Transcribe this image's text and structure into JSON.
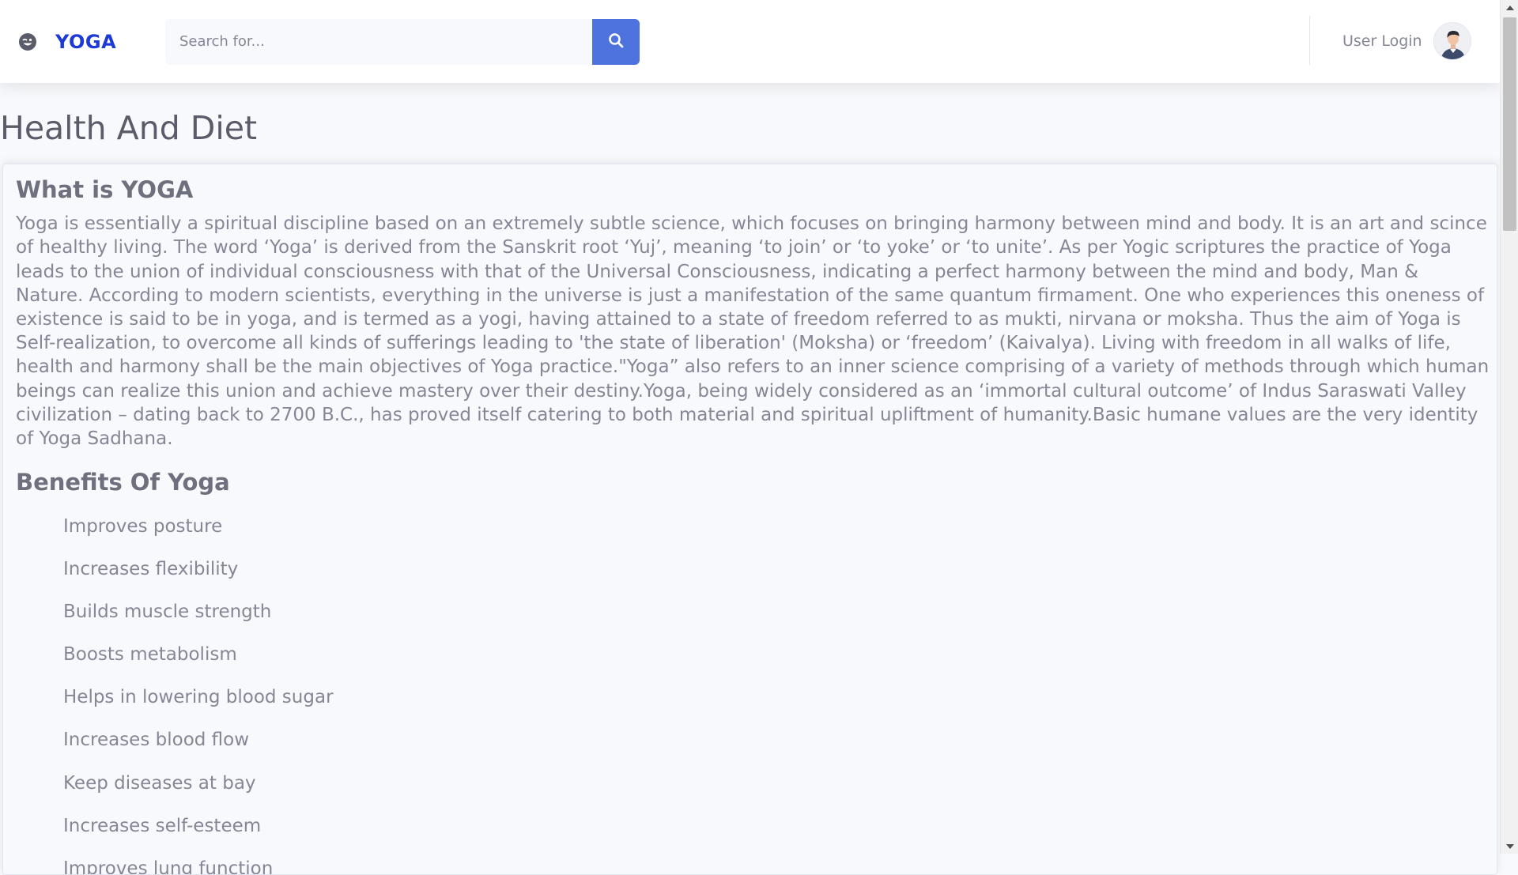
{
  "header": {
    "brand": "YOGA",
    "brand_icon": "wink-face-icon",
    "search": {
      "placeholder": "Search for...",
      "value": "",
      "button_icon": "search-icon"
    },
    "user": {
      "label": "User Login",
      "avatar_icon": "user-avatar"
    }
  },
  "page": {
    "title": "Health And Diet"
  },
  "content": {
    "section1": {
      "heading": "What is YOGA",
      "text": "Yoga is essentially a spiritual discipline based on an extremely subtle science, which focuses on bringing harmony between mind and body. It is an art and scince of healthy living. The word ‘Yoga’ is derived from the Sanskrit root ‘Yuj’, meaning ‘to join’ or ‘to yoke’ or ‘to unite’. As per Yogic scriptures the practice of Yoga leads to the union of individual consciousness with that of the Universal Consciousness, indicating a perfect harmony between the mind and body, Man & Nature. According to modern scientists, everything in the universe is just a manifestation of the same quantum firmament. One who experiences this oneness of existence is said to be in yoga, and is termed as a yogi, having attained to a state of freedom referred to as mukti, nirvana or moksha. Thus the aim of Yoga is Self-realization, to overcome all kinds of sufferings leading to 'the state of liberation' (Moksha) or ‘freedom’ (Kaivalya). Living with freedom in all walks of life, health and harmony shall be the main objectives of Yoga practice.\"Yoga” also refers to an inner science comprising of a variety of methods through which human beings can realize this union and achieve mastery over their destiny.Yoga, being widely considered as an ‘immortal cultural outcome’ of Indus Saraswati Valley civilization – dating back to 2700 B.C., has proved itself catering to both material and spiritual upliftment of humanity.Basic humane values are the very identity of Yoga Sadhana."
    },
    "section2": {
      "heading": "Benefits Of Yoga",
      "items": [
        "Improves posture",
        "Increases flexibility",
        "Builds muscle strength",
        "Boosts metabolism",
        "Helps in lowering blood sugar",
        "Increases blood flow",
        "Keep diseases at bay",
        "Increases self-esteem",
        "Improves lung function"
      ]
    }
  },
  "colors": {
    "brand": "#1d3ad6",
    "primary": "#4e73df",
    "text": "#858796",
    "background": "#f8f9fc"
  }
}
